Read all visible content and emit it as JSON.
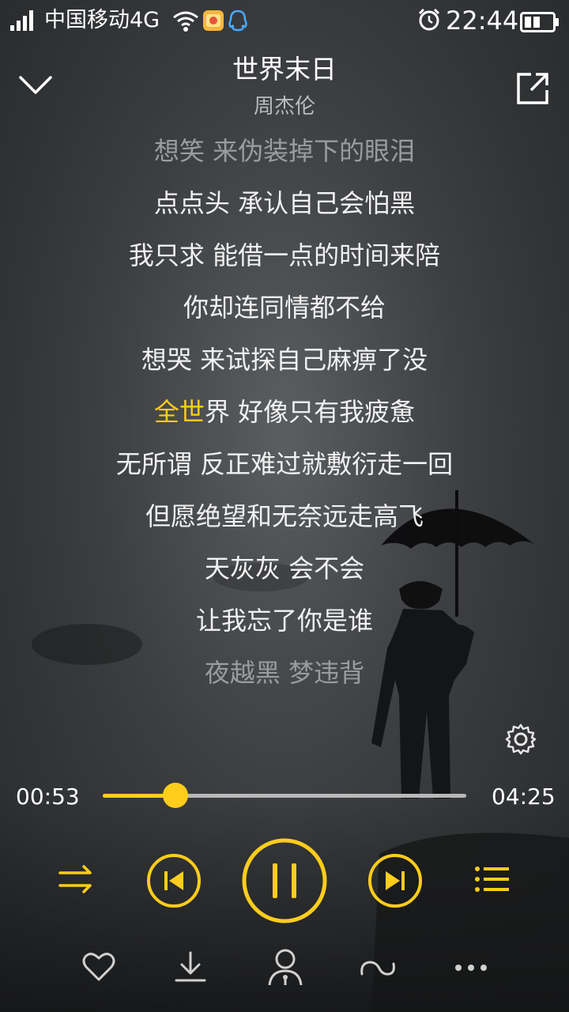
{
  "status_bar": {
    "carrier": "中国移动4G",
    "time": "22:44",
    "icons": [
      "signal-icon",
      "wifi-icon",
      "app-notification-icon",
      "qq-icon",
      "alarm-icon",
      "battery-icon"
    ]
  },
  "header": {
    "title": "世界末日",
    "artist": "周杰伦",
    "icons": [
      "chevron-down-icon",
      "share-icon"
    ]
  },
  "lyrics": {
    "lines": [
      {
        "text": "想笑 来伪装掉下的眼泪",
        "state": "dim"
      },
      {
        "text": "点点头 承认自己会怕黑",
        "state": "normal"
      },
      {
        "text": "我只求 能借一点的时间来陪",
        "state": "normal"
      },
      {
        "text": "你却连同情都不给",
        "state": "normal"
      },
      {
        "text": "想哭 来试探自己麻痹了没",
        "state": "normal"
      },
      {
        "text": "全世界 好像只有我疲惫",
        "state": "current",
        "highlighted_part": "全世",
        "rest": "界 好像只有我疲惫"
      },
      {
        "text": "无所谓 反正难过就敷衍走一回",
        "state": "normal"
      },
      {
        "text": "但愿绝望和无奈远走高飞",
        "state": "normal"
      },
      {
        "text": "天灰灰 会不会",
        "state": "normal"
      },
      {
        "text": "让我忘了你是谁",
        "state": "normal"
      },
      {
        "text": "夜越黑 梦违背",
        "state": "dim"
      }
    ]
  },
  "player": {
    "current_time": "00:53",
    "total_time": "04:25",
    "progress": 0.2,
    "accent_color": "#ffcd1c",
    "controls": [
      "shuffle-icon",
      "previous-icon",
      "pause-icon",
      "next-icon",
      "playlist-icon"
    ]
  },
  "bottom_bar": {
    "icons": [
      "heart-icon",
      "download-icon",
      "singer-icon",
      "repeat-loop-icon",
      "more-icon"
    ]
  }
}
